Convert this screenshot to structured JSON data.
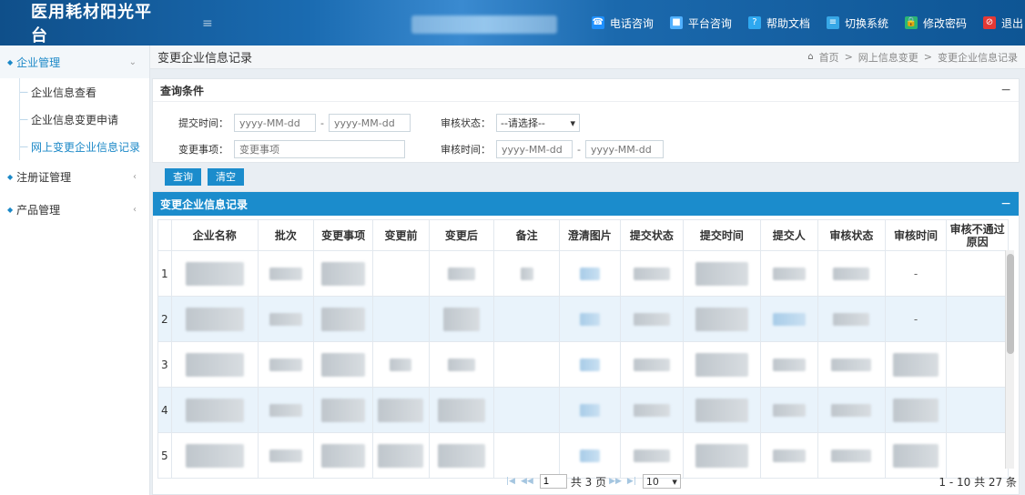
{
  "header": {
    "logo": "医用耗材阳光平台",
    "menu_toggle": "≡",
    "actions": [
      {
        "label": "电话咨询",
        "icon": "phone-icon"
      },
      {
        "label": "平台咨询",
        "icon": "chat-icon"
      },
      {
        "label": "帮助文档",
        "icon": "help-icon"
      },
      {
        "label": "切换系统",
        "icon": "switch-icon"
      },
      {
        "label": "修改密码",
        "icon": "lock-icon"
      },
      {
        "label": "退出",
        "icon": "logout-icon"
      }
    ]
  },
  "sidebar": {
    "groups": [
      {
        "label": "企业管理",
        "expanded": true,
        "items": [
          "企业信息查看",
          "企业信息变更申请",
          "网上变更企业信息记录"
        ]
      },
      {
        "label": "注册证管理",
        "expanded": false
      },
      {
        "label": "产品管理",
        "expanded": false
      }
    ]
  },
  "breadcrumb": {
    "title": "变更企业信息记录",
    "items": [
      "首页",
      ">",
      "网上信息变更",
      ">",
      "变更企业信息记录"
    ]
  },
  "query": {
    "title": "查询条件",
    "collapse": "−",
    "submit_time_label": "提交时间：",
    "date_placeholder": "yyyy-MM-dd",
    "range_sep": "-",
    "review_status_label": "审核状态：",
    "review_status_value": "--请选择--",
    "change_item_label": "变更事项：",
    "change_item_placeholder": "变更事项",
    "review_time_label": "审核时间：",
    "search_button": "查询",
    "clear_button": "清空"
  },
  "grid": {
    "title": "变更企业信息记录",
    "collapse": "−",
    "columns": [
      "企业名称",
      "批次",
      "变更事项",
      "变更前",
      "变更后",
      "备注",
      "澄清图片",
      "提交状态",
      "提交时间",
      "提交人",
      "审核状态",
      "审核时间",
      "审核不通过原因"
    ],
    "rows": [
      "1",
      "2",
      "3",
      "4",
      "5"
    ],
    "dash": "-"
  },
  "pager": {
    "current_page": "1",
    "total_pages": "共 3 页",
    "page_size": "10",
    "summary": "1 - 10  共 27 条"
  }
}
